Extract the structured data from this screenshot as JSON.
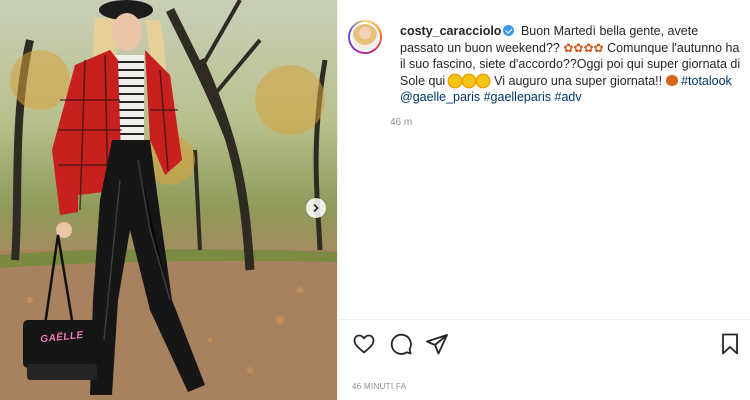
{
  "post": {
    "username": "costy_caracciolo",
    "caption_1": "Buon Martedì bella gente, avete passato un buon weekend??",
    "caption_2": "Comunque l'autunno ha il suo fascino, siete d'accordo??Oggi poi qui super giornata di Sole qui",
    "caption_3": "Vi auguro una super giornata!!",
    "hashtag_totallook": "#totalook",
    "mention": "@gaelle_paris",
    "hashtag_gaelleparis": "#gaelleparis",
    "hashtag_adv": "#adv",
    "comment_time": "46 m",
    "post_time": "46 MINUTI FA"
  },
  "bag": {
    "brand_text": "GAËLLE"
  },
  "icons": {
    "verified": "verified-badge-icon",
    "leaf": "maple-leaf-emoji",
    "sun": "sun-emoji",
    "chestnut": "chestnut-emoji",
    "like": "heart-icon",
    "comment": "comment-icon",
    "share": "paper-plane-icon",
    "save": "bookmark-icon",
    "next": "chevron-right-icon"
  },
  "colors": {
    "link": "#00376b",
    "verified": "#3897f0",
    "muted": "#8e8e8e",
    "text": "#262626"
  }
}
